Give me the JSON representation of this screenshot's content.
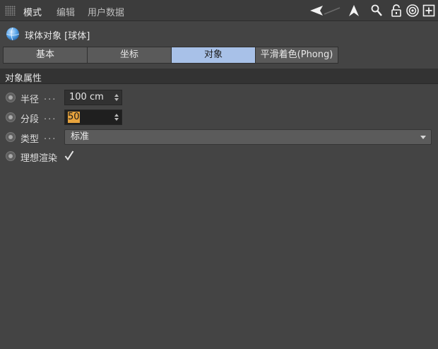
{
  "menubar": {
    "items": [
      "模式",
      "编辑",
      "用户数据"
    ]
  },
  "toolbar_icons": [
    "back-arrow-icon",
    "up-arrow-icon",
    "search-icon",
    "lock-icon",
    "target-icon",
    "new-panel-icon"
  ],
  "object": {
    "icon": "sphere-icon",
    "title": "球体对象 [球体]"
  },
  "tabs": [
    {
      "label": "基本",
      "active": false
    },
    {
      "label": "坐标",
      "active": false
    },
    {
      "label": "对象",
      "active": true
    },
    {
      "label": "平滑着色(Phong)",
      "active": false
    }
  ],
  "section": {
    "title": "对象属性"
  },
  "properties": {
    "radius": {
      "label": "半径",
      "dots": "...",
      "value": "100 cm"
    },
    "segments": {
      "label": "分段",
      "dots": "...",
      "value": "50"
    },
    "type": {
      "label": "类型",
      "dots": "...",
      "value": "标准"
    },
    "render_perfect": {
      "label": "理想渲染",
      "checked": true
    }
  },
  "colors": {
    "background": "#444444",
    "active_tab": "#a8c1e8",
    "cursor_highlight": "#e7a33d"
  }
}
